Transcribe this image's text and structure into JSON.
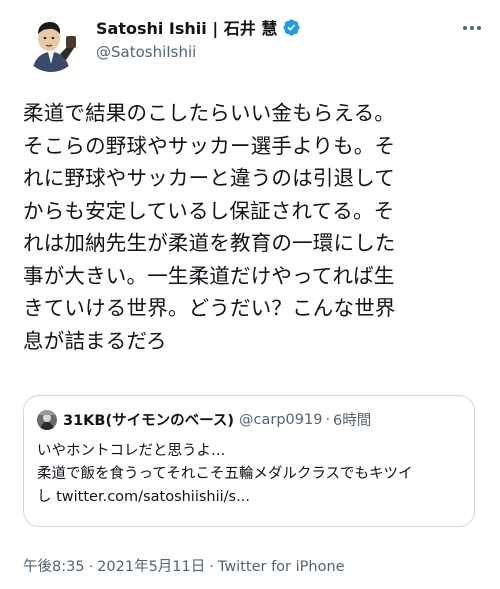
{
  "author": {
    "display_name": "Satoshi Ishii | 石井 慧",
    "handle": "@SatoshiIshii",
    "verified": true,
    "avatar_icon": "caricature-avatar-icon"
  },
  "more_icon": "more-options-icon",
  "tweet": {
    "text": "柔道で結果のこしたらいい金もらえる。\nそこらの野球やサッカー選手よりも。そ\nれに野球やサッカーと違うのは引退して\nからも安定しているし保証されてる。そ\nれは加納先生が柔道を教育の一環にした\n事が大きい。一生柔道だけやってれば生\nきていける世界。どうだい？こんな世界\n息が詰まるだろ"
  },
  "quote": {
    "name": "31KB(サイモンのベース)",
    "handle": "@carp0919",
    "separator": "·",
    "time": "6時間",
    "text": "いやホントコレだと思うよ…\n柔道で飯を食うってそれこそ五輪メダルクラスでもキツイ\nし twitter.com/satoshiishii/s..."
  },
  "footer": {
    "time": "午後8:35",
    "sep1": "·",
    "date": "2021年5月11日",
    "sep2": "·",
    "source": "Twitter for iPhone"
  },
  "colors": {
    "verified_blue": "#1d9bf0",
    "secondary_text": "#536471",
    "border": "#cfd9de"
  }
}
